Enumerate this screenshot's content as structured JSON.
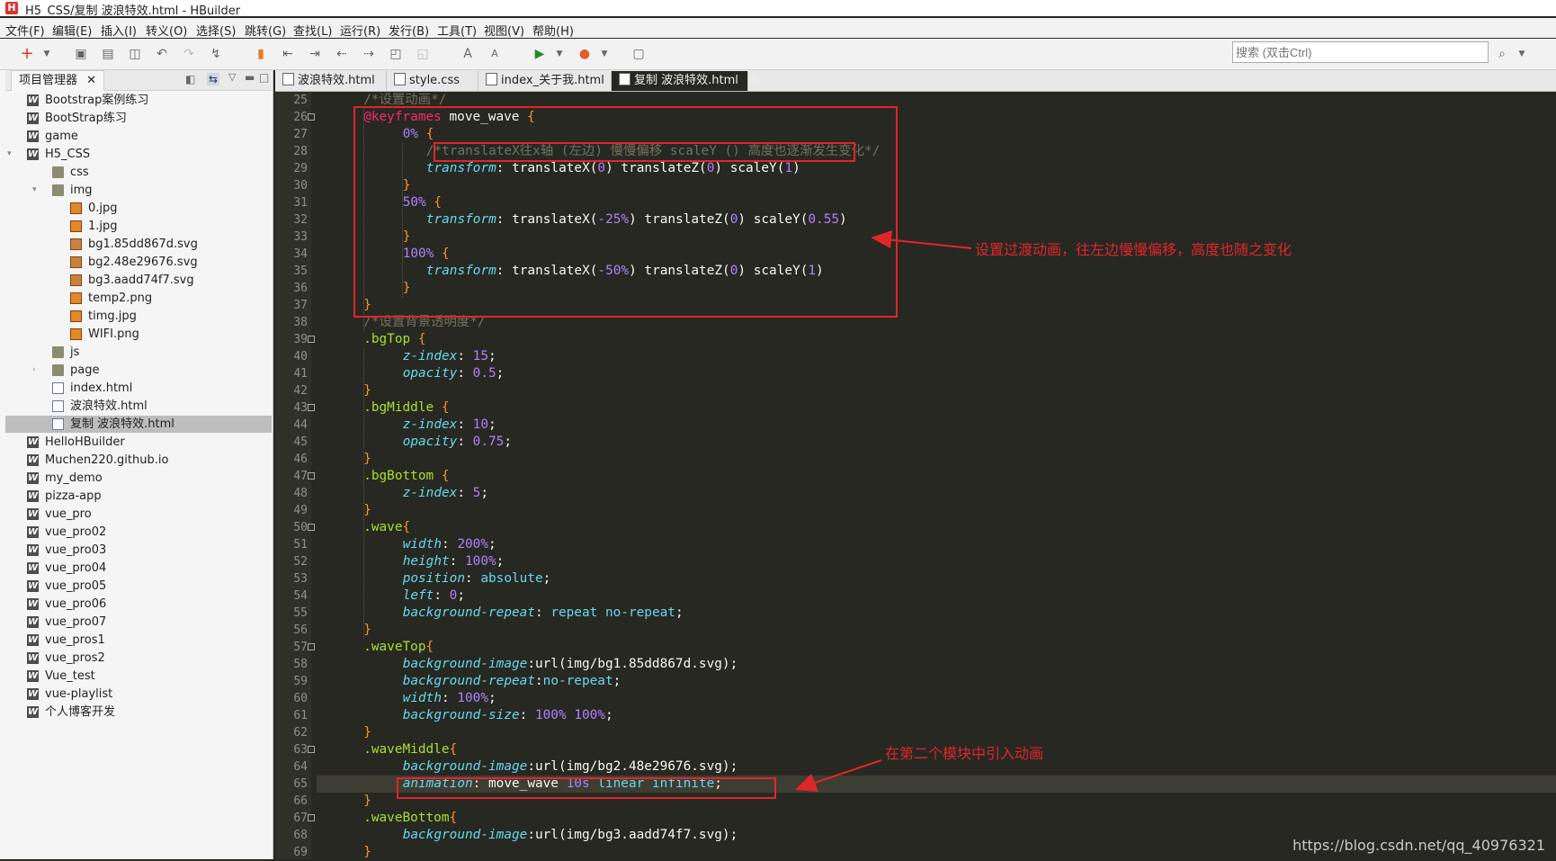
{
  "window": {
    "title": "H5_CSS/复制 波浪特效.html  -  HBuilder"
  },
  "menu": [
    "文件(F)",
    "编辑(E)",
    "插入(I)",
    "转义(O)",
    "选择(S)",
    "跳转(G)",
    "查找(L)",
    "运行(R)",
    "发行(B)",
    "工具(T)",
    "视图(V)",
    "帮助(H)"
  ],
  "search": {
    "placeholder": "搜索 (双击Ctrl)"
  },
  "sidebar": {
    "tab_label": "项目管理器",
    "tree": [
      {
        "label": "Bootstrap案例练习",
        "icon": "w"
      },
      {
        "label": "BootStrap练习",
        "icon": "w"
      },
      {
        "label": "game",
        "icon": "w"
      },
      {
        "label": "H5_CSS",
        "icon": "w"
      },
      {
        "label": "css",
        "icon": "folder"
      },
      {
        "label": "img",
        "icon": "folder"
      },
      {
        "label": "0.jpg",
        "icon": "img"
      },
      {
        "label": "1.jpg",
        "icon": "img"
      },
      {
        "label": "bg1.85dd867d.svg",
        "icon": "svg"
      },
      {
        "label": "bg2.48e29676.svg",
        "icon": "svg"
      },
      {
        "label": "bg3.aadd74f7.svg",
        "icon": "svg"
      },
      {
        "label": "temp2.png",
        "icon": "img"
      },
      {
        "label": "timg.jpg",
        "icon": "img"
      },
      {
        "label": "WIFI.png",
        "icon": "img"
      },
      {
        "label": "js",
        "icon": "folder"
      },
      {
        "label": "page",
        "icon": "folder"
      },
      {
        "label": "index.html",
        "icon": "html"
      },
      {
        "label": "波浪特效.html",
        "icon": "html"
      },
      {
        "label": "复制 波浪特效.html",
        "icon": "html"
      },
      {
        "label": "HelloHBuilder",
        "icon": "w"
      },
      {
        "label": "Muchen220.github.io",
        "icon": "w"
      },
      {
        "label": "my_demo",
        "icon": "w"
      },
      {
        "label": "pizza-app",
        "icon": "w"
      },
      {
        "label": "vue_pro",
        "icon": "w"
      },
      {
        "label": "vue_pro02",
        "icon": "w"
      },
      {
        "label": "vue_pro03",
        "icon": "w"
      },
      {
        "label": "vue_pro04",
        "icon": "w"
      },
      {
        "label": "vue_pro05",
        "icon": "w"
      },
      {
        "label": "vue_pro06",
        "icon": "w"
      },
      {
        "label": "vue_pro07",
        "icon": "w"
      },
      {
        "label": "vue_pros1",
        "icon": "w"
      },
      {
        "label": "vue_pros2",
        "icon": "w"
      },
      {
        "label": "Vue_test",
        "icon": "w"
      },
      {
        "label": "vue-playlist",
        "icon": "w"
      },
      {
        "label": "个人博客开发",
        "icon": "w"
      }
    ]
  },
  "editor": {
    "tabs": [
      {
        "label": "波浪特效.html"
      },
      {
        "label": "style.css"
      },
      {
        "label": "index_关于我.html"
      },
      {
        "label": "复制 波浪特效.html"
      }
    ],
    "lines": [
      {
        "n": "25",
        "t": [
          [
            "c",
            "/*设置动画*/"
          ]
        ]
      },
      {
        "n": "26",
        "t": [
          [
            "k",
            "@keyframes"
          ],
          [
            "x",
            " move_wave "
          ],
          [
            "p",
            "{"
          ]
        ]
      },
      {
        "n": "27",
        "t": [
          [
            "n",
            "0%"
          ],
          [
            "x",
            " "
          ],
          [
            "p",
            "{"
          ]
        ]
      },
      {
        "n": "28",
        "t": [
          [
            "c",
            "/*translateX往x轴 (左边) 慢慢偏移 scaleY () 高度也逐渐发生变化*/"
          ]
        ]
      },
      {
        "n": "29",
        "t": [
          [
            "i",
            "transform"
          ],
          [
            "x",
            ": translateX("
          ],
          [
            "n",
            "0"
          ],
          [
            "x",
            ") translateZ("
          ],
          [
            "n",
            "0"
          ],
          [
            "x",
            ") scaleY("
          ],
          [
            "n",
            "1"
          ],
          [
            "x",
            ")"
          ]
        ]
      },
      {
        "n": "30",
        "t": [
          [
            "p",
            "}"
          ]
        ]
      },
      {
        "n": "31",
        "t": [
          [
            "n",
            "50%"
          ],
          [
            "x",
            " "
          ],
          [
            "p",
            "{"
          ]
        ]
      },
      {
        "n": "32",
        "t": [
          [
            "i",
            "transform"
          ],
          [
            "x",
            ": translateX("
          ],
          [
            "n",
            "-25%"
          ],
          [
            "x",
            ") translateZ("
          ],
          [
            "n",
            "0"
          ],
          [
            "x",
            ") scaleY("
          ],
          [
            "n",
            "0.55"
          ],
          [
            "x",
            ")"
          ]
        ]
      },
      {
        "n": "33",
        "t": [
          [
            "p",
            "}"
          ]
        ]
      },
      {
        "n": "34",
        "t": [
          [
            "n",
            "100%"
          ],
          [
            "x",
            " "
          ],
          [
            "p",
            "{"
          ]
        ]
      },
      {
        "n": "35",
        "t": [
          [
            "i",
            "transform"
          ],
          [
            "x",
            ": translateX("
          ],
          [
            "n",
            "-50%"
          ],
          [
            "x",
            ") translateZ("
          ],
          [
            "n",
            "0"
          ],
          [
            "x",
            ") scaleY("
          ],
          [
            "n",
            "1"
          ],
          [
            "x",
            ")"
          ]
        ]
      },
      {
        "n": "36",
        "t": [
          [
            "p",
            "}"
          ]
        ]
      },
      {
        "n": "37",
        "t": [
          [
            "p",
            "}"
          ]
        ]
      },
      {
        "n": "38",
        "t": [
          [
            "c",
            "/*设置背景透明度*/"
          ]
        ]
      },
      {
        "n": "39",
        "t": [
          [
            "a",
            ".bgTop"
          ],
          [
            "x",
            " "
          ],
          [
            "p",
            "{"
          ]
        ]
      },
      {
        "n": "40",
        "t": [
          [
            "i",
            "z-index"
          ],
          [
            "x",
            ": "
          ],
          [
            "n",
            "15"
          ],
          [
            "x",
            ";"
          ]
        ]
      },
      {
        "n": "41",
        "t": [
          [
            "i",
            "opacity"
          ],
          [
            "x",
            ": "
          ],
          [
            "n",
            "0.5"
          ],
          [
            "x",
            ";"
          ]
        ]
      },
      {
        "n": "42",
        "t": [
          [
            "p",
            "}"
          ]
        ]
      },
      {
        "n": "43",
        "t": [
          [
            "a",
            ".bgMiddle"
          ],
          [
            "x",
            " "
          ],
          [
            "p",
            "{"
          ]
        ]
      },
      {
        "n": "44",
        "t": [
          [
            "i",
            "z-index"
          ],
          [
            "x",
            ": "
          ],
          [
            "n",
            "10"
          ],
          [
            "x",
            ";"
          ]
        ]
      },
      {
        "n": "45",
        "t": [
          [
            "i",
            "opacity"
          ],
          [
            "x",
            ": "
          ],
          [
            "n",
            "0.75"
          ],
          [
            "x",
            ";"
          ]
        ]
      },
      {
        "n": "46",
        "t": [
          [
            "p",
            "}"
          ]
        ]
      },
      {
        "n": "47",
        "t": [
          [
            "a",
            ".bgBottom"
          ],
          [
            "x",
            " "
          ],
          [
            "p",
            "{"
          ]
        ]
      },
      {
        "n": "48",
        "t": [
          [
            "i",
            "z-index"
          ],
          [
            "x",
            ": "
          ],
          [
            "n",
            "5"
          ],
          [
            "x",
            ";"
          ]
        ]
      },
      {
        "n": "49",
        "t": [
          [
            "p",
            "}"
          ]
        ]
      },
      {
        "n": "50",
        "t": [
          [
            "a",
            ".wave"
          ],
          [
            "p",
            "{"
          ]
        ]
      },
      {
        "n": "51",
        "t": [
          [
            "i",
            "width"
          ],
          [
            "x",
            ": "
          ],
          [
            "n",
            "200%"
          ],
          [
            "x",
            ";"
          ]
        ]
      },
      {
        "n": "52",
        "t": [
          [
            "i",
            "height"
          ],
          [
            "x",
            ": "
          ],
          [
            "n",
            "100%"
          ],
          [
            "x",
            ";"
          ]
        ]
      },
      {
        "n": "53",
        "t": [
          [
            "i",
            "position"
          ],
          [
            "x",
            ": "
          ],
          [
            "s",
            "absolute"
          ],
          [
            "x",
            ";"
          ]
        ]
      },
      {
        "n": "54",
        "t": [
          [
            "i",
            "left"
          ],
          [
            "x",
            ": "
          ],
          [
            "n",
            "0"
          ],
          [
            "x",
            ";"
          ]
        ]
      },
      {
        "n": "55",
        "t": [
          [
            "i",
            "background-repeat"
          ],
          [
            "x",
            ": "
          ],
          [
            "s",
            "repeat no-repeat"
          ],
          [
            "x",
            ";"
          ]
        ]
      },
      {
        "n": "56",
        "t": [
          [
            "p",
            "}"
          ]
        ]
      },
      {
        "n": "57",
        "t": [
          [
            "a",
            ".waveTop"
          ],
          [
            "p",
            "{"
          ]
        ]
      },
      {
        "n": "58",
        "t": [
          [
            "i",
            "background-image"
          ],
          [
            "x",
            ":url(img/bg1.85dd867d.svg);"
          ]
        ]
      },
      {
        "n": "59",
        "t": [
          [
            "i",
            "background-repeat"
          ],
          [
            "x",
            ":"
          ],
          [
            "s",
            "no-repeat"
          ],
          [
            "x",
            ";"
          ]
        ]
      },
      {
        "n": "60",
        "t": [
          [
            "i",
            "width"
          ],
          [
            "x",
            ": "
          ],
          [
            "n",
            "100%"
          ],
          [
            "x",
            ";"
          ]
        ]
      },
      {
        "n": "61",
        "t": [
          [
            "i",
            "background-size"
          ],
          [
            "x",
            ": "
          ],
          [
            "n",
            "100%"
          ],
          [
            "x",
            " "
          ],
          [
            "n",
            "100%"
          ],
          [
            "x",
            ";"
          ]
        ]
      },
      {
        "n": "62",
        "t": [
          [
            "p",
            "}"
          ]
        ]
      },
      {
        "n": "63",
        "t": [
          [
            "a",
            ".waveMiddle"
          ],
          [
            "p",
            "{"
          ]
        ]
      },
      {
        "n": "64",
        "t": [
          [
            "i",
            "background-image"
          ],
          [
            "x",
            ":url(img/bg2.48e29676.svg);"
          ]
        ]
      },
      {
        "n": "65",
        "t": [
          [
            "i",
            "animation"
          ],
          [
            "x",
            ": move_wave "
          ],
          [
            "n",
            "10s"
          ],
          [
            "x",
            " "
          ],
          [
            "s",
            "linear infinite"
          ],
          [
            "x",
            ";"
          ]
        ]
      },
      {
        "n": "66",
        "t": [
          [
            "p",
            "}"
          ]
        ]
      },
      {
        "n": "67",
        "t": [
          [
            "a",
            ".waveBottom"
          ],
          [
            "p",
            "{"
          ]
        ]
      },
      {
        "n": "68",
        "t": [
          [
            "i",
            "background-image"
          ],
          [
            "x",
            ":url(img/bg3.aadd74f7.svg);"
          ]
        ]
      },
      {
        "n": "69",
        "t": [
          [
            "p",
            "}"
          ]
        ]
      }
    ]
  },
  "annotations": {
    "keyframes_note": "设置过渡动画，往左边慢慢偏移，高度也随之变化",
    "animation_note": "在第二个模块中引入动画"
  },
  "watermark": "https://blog.csdn.net/qq_40976321",
  "colors": {
    "editor_bg": "#272822",
    "annotation_red": "#e0262a",
    "keyword": "#f92672",
    "number": "#ae81ff",
    "comment": "#75715e",
    "selector": "#a6e22e"
  }
}
